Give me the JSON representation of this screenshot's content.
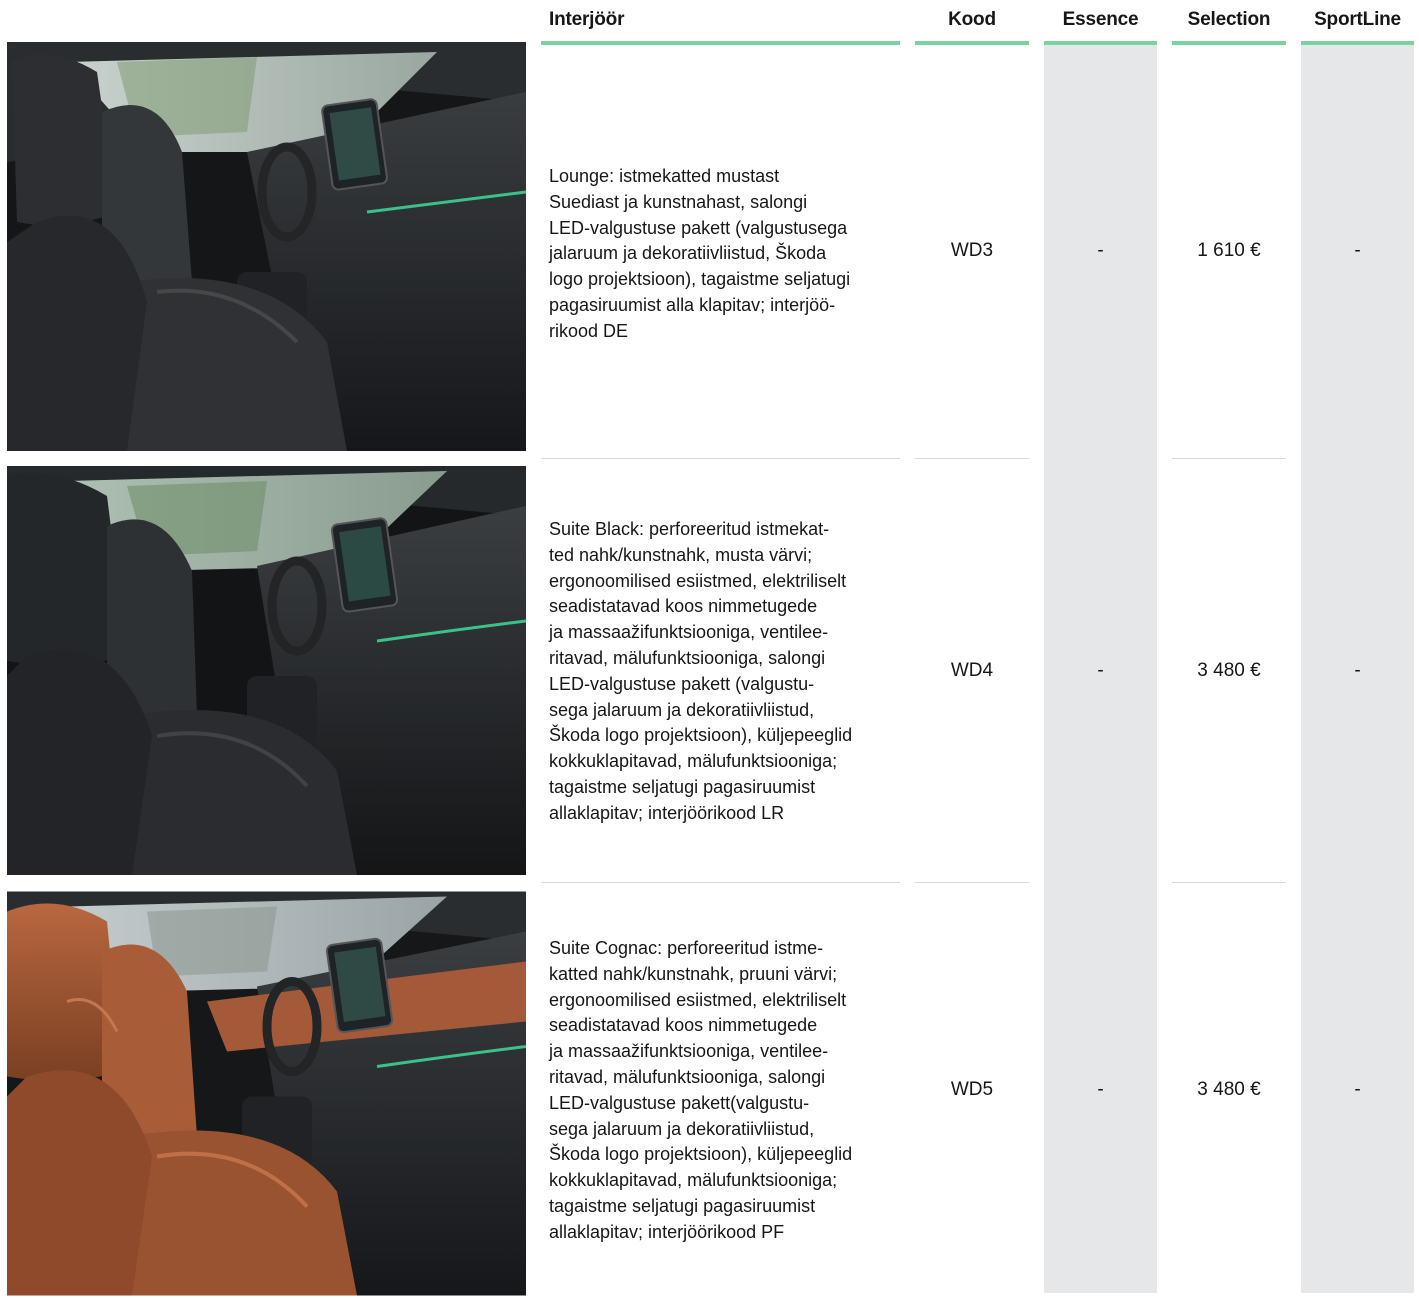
{
  "table": {
    "headers": {
      "interior": "Interjöör",
      "code": "Kood",
      "essence": "Essence",
      "selection": "Selection",
      "sportline": "SportLine"
    },
    "rows": [
      {
        "image": "black-suedia-interior-photo",
        "description_lines": [
          "Lounge: istmekatted mustast",
          "Suediast ja kunstnahast, salongi",
          "LED-valgustuse pakett (valgustusega",
          "jalaruum ja dekoratiivliistud, Škoda",
          "logo projektsioon), tagaistme seljatugi",
          "pagasiruumist alla klapitav; interjöö-",
          "rikood DE"
        ],
        "code": "WD3",
        "essence": "-",
        "selection": "1 610 €",
        "sportline": "-"
      },
      {
        "image": "black-leather-interior-photo",
        "description_lines": [
          "Suite Black: perforeeritud istmekat-",
          "ted nahk/kunstnahk, musta värvi;",
          "ergonoomilised esiistmed, elektriliselt",
          "seadistatavad koos nimmetugede",
          "ja massaažifunktsiooniga, ventilee-",
          "ritavad, mälufunktsiooniga, salongi",
          "LED-valgustuse pakett (valgustu-",
          "sega jalaruum ja dekoratiivliistud,",
          "Škoda logo projektsioon), küljepeeglid",
          "kokkuklapitavad, mälufunktsiooniga;",
          "tagaistme seljatugi pagasiruumist",
          "allaklapitav; interjöörikood LR"
        ],
        "code": "WD4",
        "essence": "-",
        "selection": "3 480 €",
        "sportline": "-"
      },
      {
        "image": "cognac-leather-interior-photo",
        "description_lines": [
          "Suite Cognac: perforeeritud istme-",
          "katted nahk/kunstnahk, pruuni värvi;",
          "ergonoomilised esiistmed, elektriliselt",
          "seadistatavad koos nimmetugede",
          "ja massaažifunktsiooniga, ventilee-",
          "ritavad, mälufunktsiooniga, salongi",
          "LED-valgustuse pakett(valgustu-",
          "sega jalaruum ja dekoratiivliistud,",
          "Škoda logo projektsioon), küljepeeglid",
          "kokkuklapitavad, mälufunktsiooniga;",
          "tagaistme seljatugi pagasiruumist",
          "allaklapitav; interjöörikood PF"
        ],
        "code": "WD5",
        "essence": "-",
        "selection": "3 480 €",
        "sportline": "-"
      }
    ]
  },
  "colors": {
    "accent_rule": "#78d3a2",
    "shaded_column": "#e6e7e8",
    "cognac_seat": "#a45a38",
    "black_seat": "#2a2b2d",
    "ambient_light": "#3ee6a0"
  }
}
